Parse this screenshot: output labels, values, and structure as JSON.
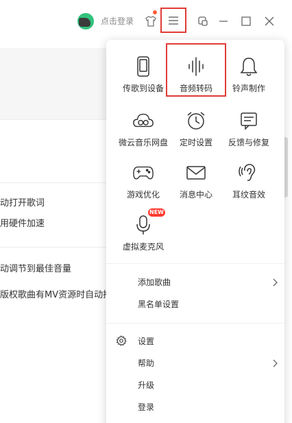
{
  "titlebar": {
    "login_label": "点击登录",
    "avatar_icon": "user-avatar-icon",
    "skin_icon": "tshirt-icon",
    "menu_icon": "hamburger-menu-icon",
    "mini_mode_icon": "mini-mode-icon",
    "minimize_icon": "minimize-icon",
    "maximize_icon": "maximize-icon",
    "close_icon": "close-icon",
    "accent_color": "#31c27c",
    "notice_dot_color": "#ff5a36"
  },
  "background": {
    "items": [
      {
        "label": "动打开歌词"
      },
      {
        "label": "用硬件加速"
      },
      {
        "label": "动调节到最佳音量"
      },
      {
        "label": "版权歌曲有MV资源时自动播"
      }
    ]
  },
  "menu": {
    "grid": [
      {
        "label": "传歌到设备",
        "icon": "phone-icon"
      },
      {
        "label": "音频转码",
        "icon": "audio-wave-icon"
      },
      {
        "label": "铃声制作",
        "icon": "bell-icon"
      },
      {
        "label": "微云音乐网盘",
        "icon": "cloud-icon"
      },
      {
        "label": "定时设置",
        "icon": "alarm-clock-icon"
      },
      {
        "label": "反馈与修复",
        "icon": "feedback-icon"
      },
      {
        "label": "游戏优化",
        "icon": "gamepad-icon"
      },
      {
        "label": "消息中心",
        "icon": "envelope-icon"
      },
      {
        "label": "耳纹音效",
        "icon": "ear-icon"
      },
      {
        "label": "虚拟麦克风",
        "icon": "microphone-icon"
      }
    ],
    "new_badge": "NEW",
    "section1": [
      {
        "label": "添加歌曲",
        "has_submenu": true
      },
      {
        "label": "黑名单设置",
        "has_submenu": false
      }
    ],
    "section2": [
      {
        "label": "设置",
        "has_submenu": false
      },
      {
        "label": "帮助",
        "has_submenu": true
      },
      {
        "label": "升级",
        "has_submenu": false
      },
      {
        "label": "登录",
        "has_submenu": false
      }
    ],
    "highlight_color": "#e03b36"
  }
}
